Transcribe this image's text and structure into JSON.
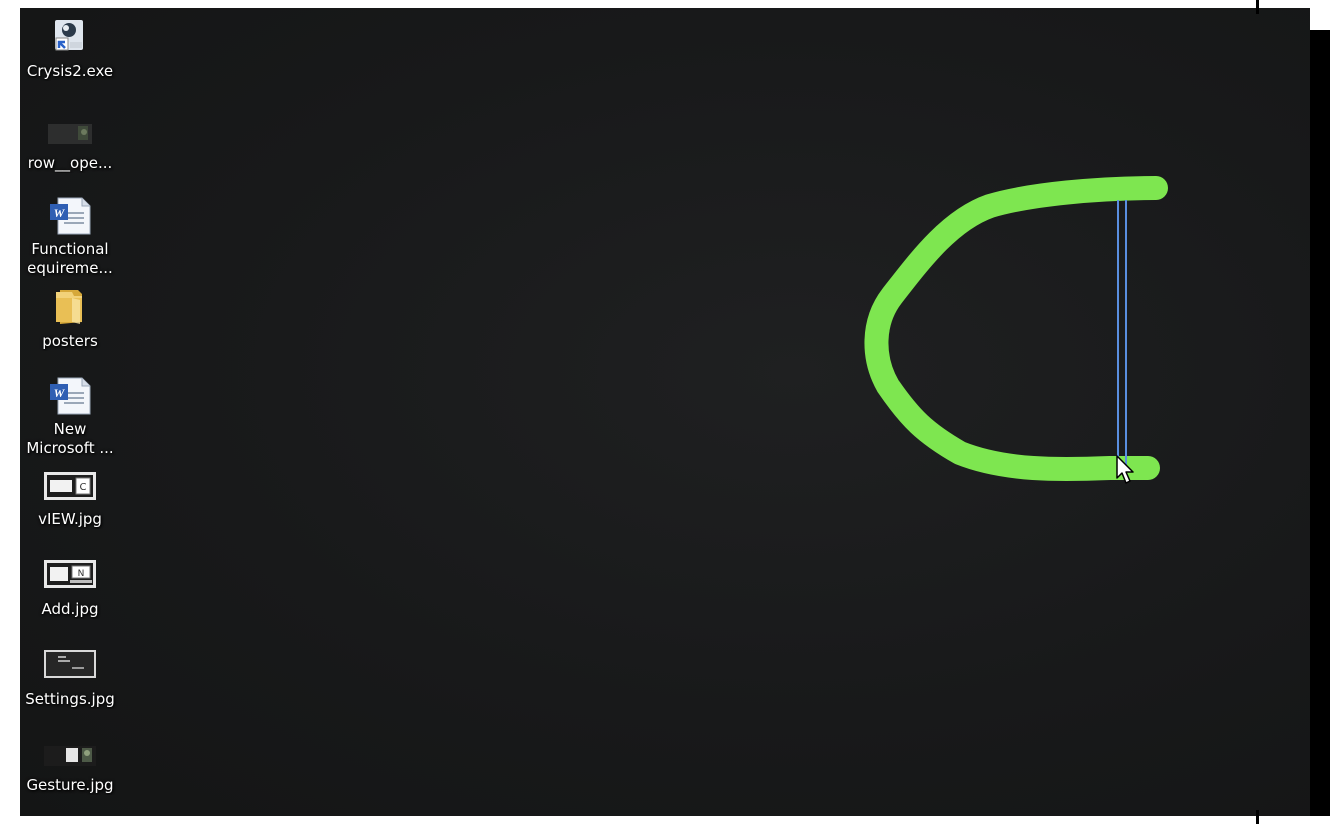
{
  "desktop": {
    "icons": [
      {
        "name": "crysis-shortcut",
        "icon": "exe-shortcut-icon",
        "lines": [
          "Crysis2.exe",
          ""
        ]
      },
      {
        "name": "video-thumbnail",
        "icon": "video-thumbnail-icon",
        "lines": [
          "row__ope...",
          ""
        ]
      },
      {
        "name": "functional-doc",
        "icon": "word-document-icon",
        "lines": [
          "Functional",
          "equireme..."
        ]
      },
      {
        "name": "posters-folder",
        "icon": "folder-icon",
        "lines": [
          "posters",
          ""
        ]
      },
      {
        "name": "new-doc",
        "icon": "word-document-icon",
        "lines": [
          "New",
          "Microsoft ..."
        ]
      },
      {
        "name": "view-jpg",
        "icon": "image-thumbnail-icon",
        "lines": [
          "vIEW.jpg",
          ""
        ]
      },
      {
        "name": "add-jpg",
        "icon": "image-thumbnail-icon",
        "lines": [
          "Add.jpg",
          ""
        ]
      },
      {
        "name": "settings-jpg",
        "icon": "image-thumbnail-icon",
        "lines": [
          "Settings.jpg",
          ""
        ]
      },
      {
        "name": "gesture-jpg",
        "icon": "image-thumbnail-icon",
        "lines": [
          "Gesture.jpg",
          ""
        ]
      }
    ]
  },
  "gesture": {
    "stroke_color": "#7ee650",
    "guide_color": "#5a8fe0",
    "cursor_icon": "arrow-cursor-icon"
  }
}
